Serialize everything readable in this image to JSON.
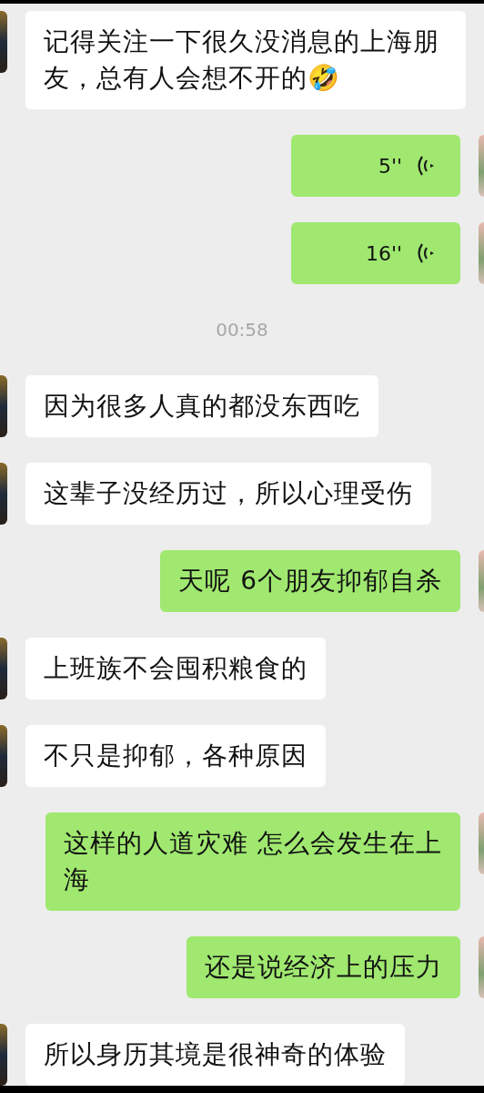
{
  "messages": [
    {
      "kind": "text",
      "outgoing": false,
      "text": "记得关注一下很久没消息的上海朋友，总有人会想不开的🤣"
    },
    {
      "kind": "voice",
      "outgoing": true,
      "duration": "5''"
    },
    {
      "kind": "voice",
      "outgoing": true,
      "duration": "16''"
    },
    {
      "kind": "time",
      "text": "00:58"
    },
    {
      "kind": "text",
      "outgoing": false,
      "text": "因为很多人真的都没东西吃"
    },
    {
      "kind": "text",
      "outgoing": false,
      "text": "这辈子没经历过，所以心理受伤"
    },
    {
      "kind": "text",
      "outgoing": true,
      "text": "天呢 6个朋友抑郁自杀"
    },
    {
      "kind": "text",
      "outgoing": false,
      "text": "上班族不会囤积粮食的"
    },
    {
      "kind": "text",
      "outgoing": false,
      "text": "不只是抑郁，各种原因"
    },
    {
      "kind": "text",
      "outgoing": true,
      "text": "这样的人道灾难 怎么会发生在上海"
    },
    {
      "kind": "text",
      "outgoing": true,
      "text": "还是说经济上的压力"
    },
    {
      "kind": "text",
      "outgoing": false,
      "text": "所以身历其境是很神奇的体验"
    }
  ]
}
